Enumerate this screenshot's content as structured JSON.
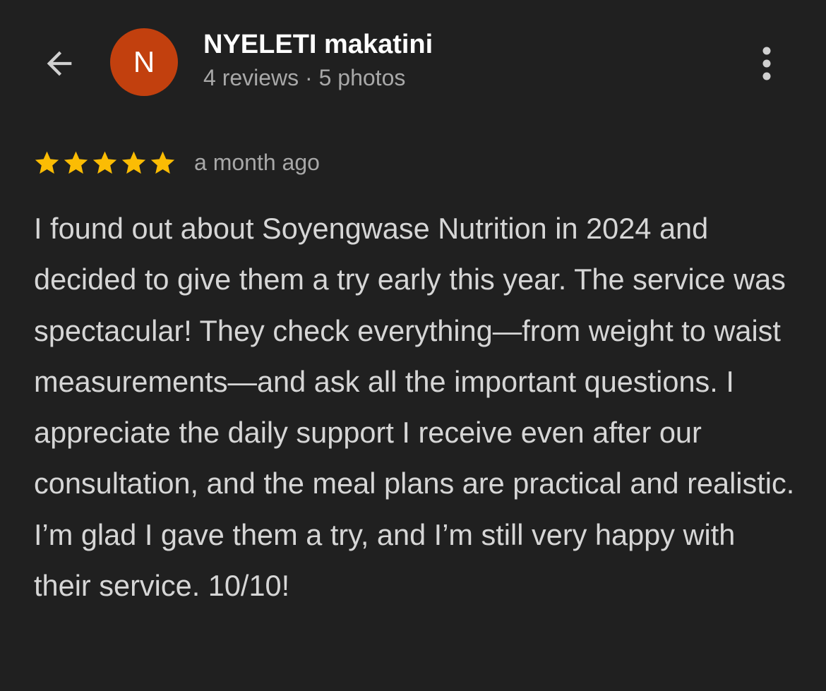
{
  "header": {
    "back_icon": "arrow-left-icon",
    "avatar_letter": "N",
    "avatar_color": "#c2400e",
    "reviewer_name": "NYELETI makatini",
    "reviewer_meta": "4 reviews · 5 photos",
    "more_icon": "more-vertical-icon"
  },
  "review": {
    "rating": 5,
    "rating_max": 5,
    "star_color": "#fbbc04",
    "time_ago": "a month ago",
    "text": "I found out about Soyengwase Nutrition in 2024 and decided to give them a try early this year. The service was spectacular! They check everything—from weight to waist measurements—and ask all the important questions. I appreciate the daily support I receive even after our consultation, and the meal plans are practical and realistic. I’m glad I gave them a try, and I’m still very happy with their service. 10/10!"
  },
  "colors": {
    "background": "#202020",
    "primary_text": "#ffffff",
    "secondary_text": "#a8a8a8",
    "body_text": "#d6d6d6"
  }
}
